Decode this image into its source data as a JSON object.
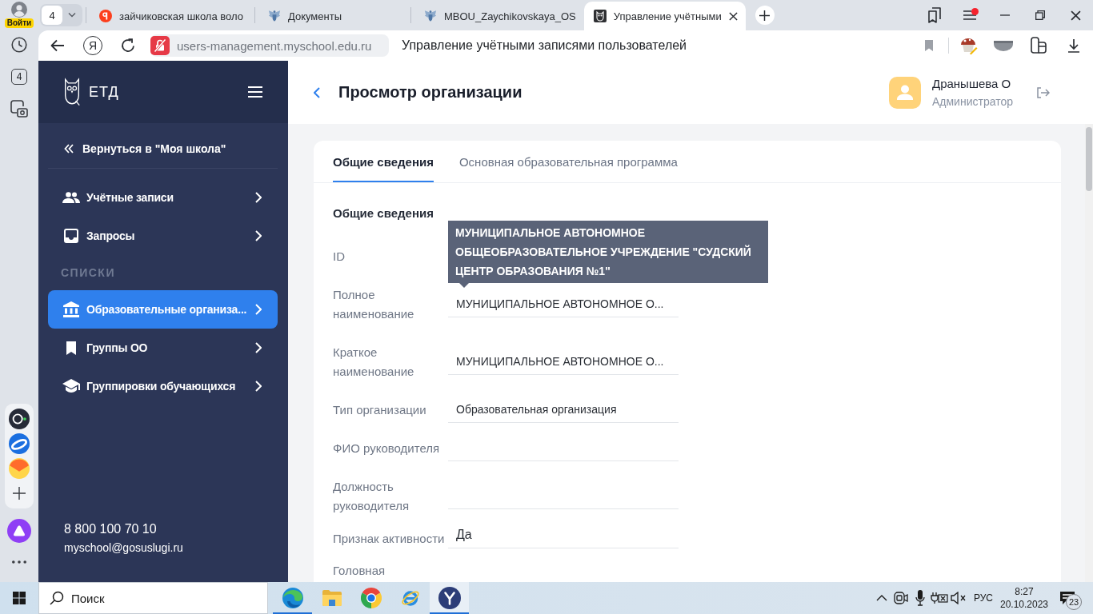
{
  "browser": {
    "profile_button": "Войти",
    "side_panel": {
      "tab_counter": "4"
    },
    "tab_counter": "4",
    "tabs": [
      {
        "title": "зайчиковская школа воло",
        "kind": "search",
        "selected": false
      },
      {
        "title": "Документы",
        "kind": "site",
        "selected": false
      },
      {
        "title": "MBOU_Zaychikovskaya_OS",
        "kind": "site",
        "selected": false
      },
      {
        "title": "Управление учётными",
        "kind": "app",
        "selected": true
      }
    ],
    "menu_notification": true,
    "home_button": "Я",
    "url": "users-management.myschool.edu.ru",
    "page_title": "Управление учётными записями пользователей"
  },
  "app": {
    "logo": "ЕТД",
    "sidebar": {
      "back_link": "Вернуться в \"Моя школа\"",
      "items": [
        {
          "label": "Учётные записи",
          "selected": false
        },
        {
          "label": "Запросы",
          "selected": false
        }
      ],
      "section": {
        "title": "СПИСКИ",
        "items": [
          {
            "label": "Образовательные организа...",
            "selected": true
          },
          {
            "label": "Группы ОО",
            "selected": false
          },
          {
            "label": "Группировки обучающихся",
            "selected": false
          }
        ]
      },
      "phone": "8 800 100 70 10",
      "email": "myschool@gosuslugi.ru"
    },
    "header": {
      "title": "Просмотр организации",
      "user": {
        "name": "Дранышева О",
        "role": "Администратор"
      }
    },
    "tabs": [
      {
        "label": "Общие сведения",
        "selected": true
      },
      {
        "label": "Основная образовательная программа",
        "selected": false
      }
    ],
    "form": {
      "title": "Общие сведения",
      "fields": [
        {
          "label": "ID",
          "kind": "text"
        },
        {
          "label": "Полное наименование",
          "value": "МУНИЦИПАЛЬНОЕ АВТОНОМНОЕ О...",
          "kind": "text"
        },
        {
          "label": "Краткое наименование",
          "value": "МУНИЦИПАЛЬНОЕ АВТОНОМНОЕ О...",
          "kind": "text"
        },
        {
          "label": "Тип организации",
          "value": "Образовательная организация",
          "kind": "text"
        },
        {
          "label": "ФИО руководителя",
          "kind": "text"
        },
        {
          "label": "Должность руководителя",
          "kind": "text"
        },
        {
          "label": "Признак активности",
          "value": "Да",
          "kind": "flag"
        },
        {
          "label": "Головная",
          "kind": "text"
        }
      ],
      "tooltip": "МУНИЦИПАЛЬНОЕ АВТОНОМНОЕ ОБЩЕОБРАЗОВАТЕЛЬНОЕ УЧРЕЖДЕНИЕ \"СУДСКИЙ ЦЕНТР ОБРАЗОВАНИЯ №1\""
    }
  },
  "taskbar": {
    "search": {
      "placeholder": "Поиск"
    },
    "apps": [
      {
        "running": true,
        "selected": false
      },
      {
        "running": false,
        "selected": false
      },
      {
        "running": false,
        "selected": false
      },
      {
        "running": false,
        "selected": false
      },
      {
        "running": true,
        "selected": true
      }
    ],
    "tray": {
      "muted": true,
      "language": "РУС",
      "time": "8:27",
      "date": "20.10.2023",
      "notifications": "23"
    }
  }
}
